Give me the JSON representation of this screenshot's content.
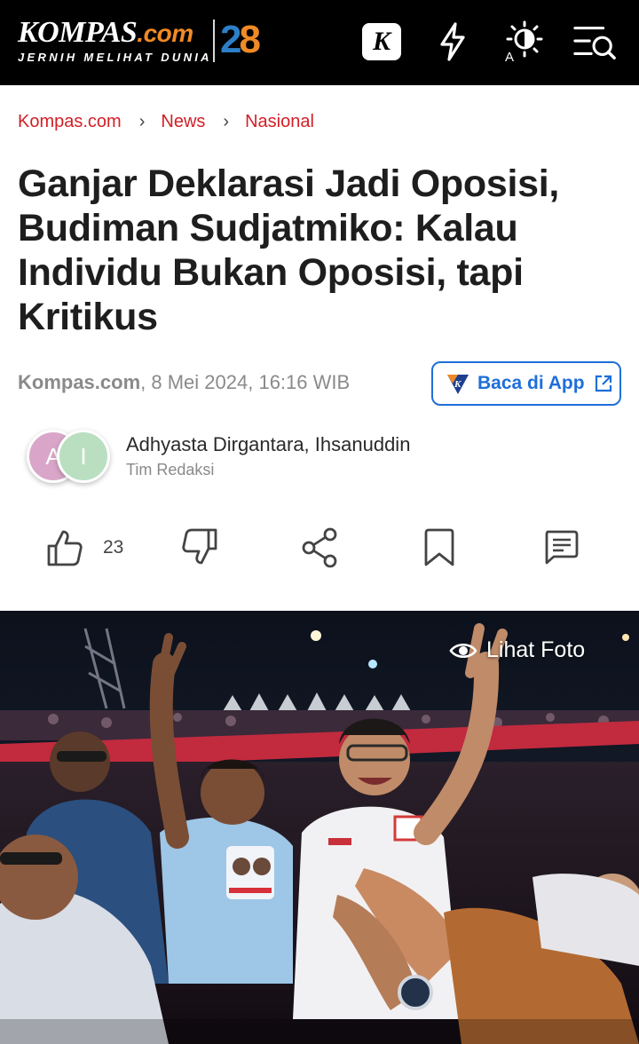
{
  "header": {
    "logo_main": "KOMPAS",
    "logo_dotcom": ".com",
    "logo_tagline": "JERNIH MELIHAT DUNIA",
    "anniversary_two": "2",
    "anniversary_eight": "8",
    "k_badge": "K",
    "icons": [
      "kompas-k-icon",
      "lightning-icon",
      "display-mode-icon",
      "menu-search-icon"
    ],
    "display_mode_letter": "A"
  },
  "breadcrumb": {
    "items": [
      "Kompas.com",
      "News",
      "Nasional"
    ],
    "separator": "›"
  },
  "article": {
    "title": "Ganjar Deklarasi Jadi Oposisi, Budiman Sudjatmiko: Kalau Individu Bukan Oposisi, tapi Kritikus",
    "source": "Kompas.com",
    "datetime": ", 8 Mei 2024, 16:16 WIB",
    "app_button": "Baca di App",
    "authors": {
      "initials": [
        "A",
        "I"
      ],
      "names": "Adhyasta Dirgantara, Ihsanuddin",
      "team": "Tim Redaksi"
    }
  },
  "actions": {
    "like_count": "23",
    "icons": [
      "thumbs-up-icon",
      "thumbs-down-icon",
      "share-icon",
      "bookmark-icon",
      "comment-icon"
    ]
  },
  "photo": {
    "view_label": "Lihat Foto"
  },
  "colors": {
    "brand_red": "#d21f26",
    "link_blue": "#1e6fd9",
    "header_bg": "#000000",
    "accent_orange": "#f08a24"
  }
}
